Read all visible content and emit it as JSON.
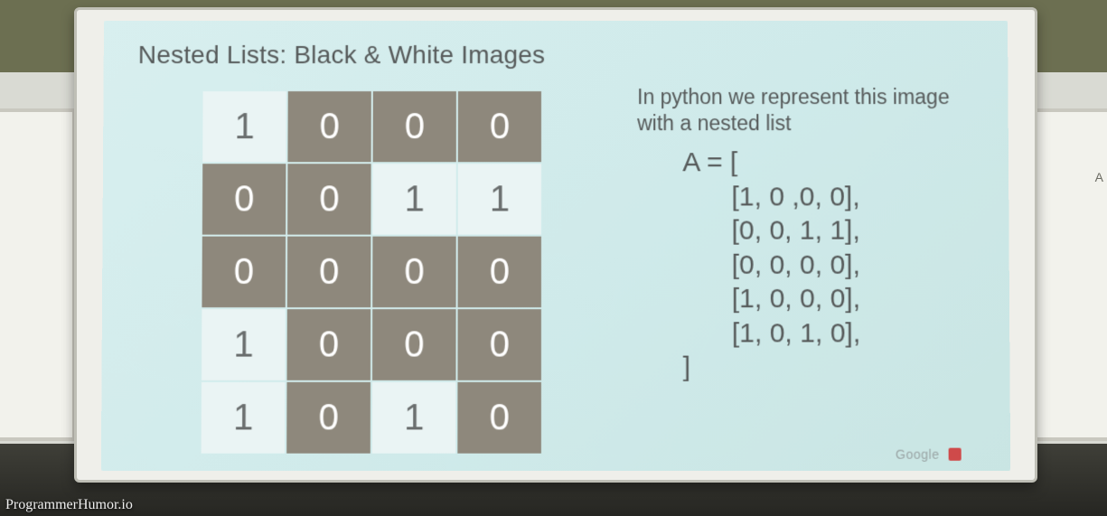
{
  "slide": {
    "title": "Nested Lists: Black & White Images",
    "description": "In python we represent this image with a nested list",
    "code": {
      "open": "A = [",
      "rows": [
        "[1, 0 ,0, 0],",
        "[0, 0, 1, 1],",
        "[0, 0, 0, 0],",
        "[1, 0, 0, 0],",
        "[1, 0, 1, 0],"
      ],
      "close": "]"
    },
    "footer_logo": "Google"
  },
  "grid": {
    "rows": [
      [
        1,
        0,
        0,
        0
      ],
      [
        0,
        0,
        1,
        1
      ],
      [
        0,
        0,
        0,
        0
      ],
      [
        1,
        0,
        0,
        0
      ],
      [
        1,
        0,
        1,
        0
      ]
    ]
  },
  "edge_text": "A",
  "watermark": "ProgrammerHumor.io"
}
